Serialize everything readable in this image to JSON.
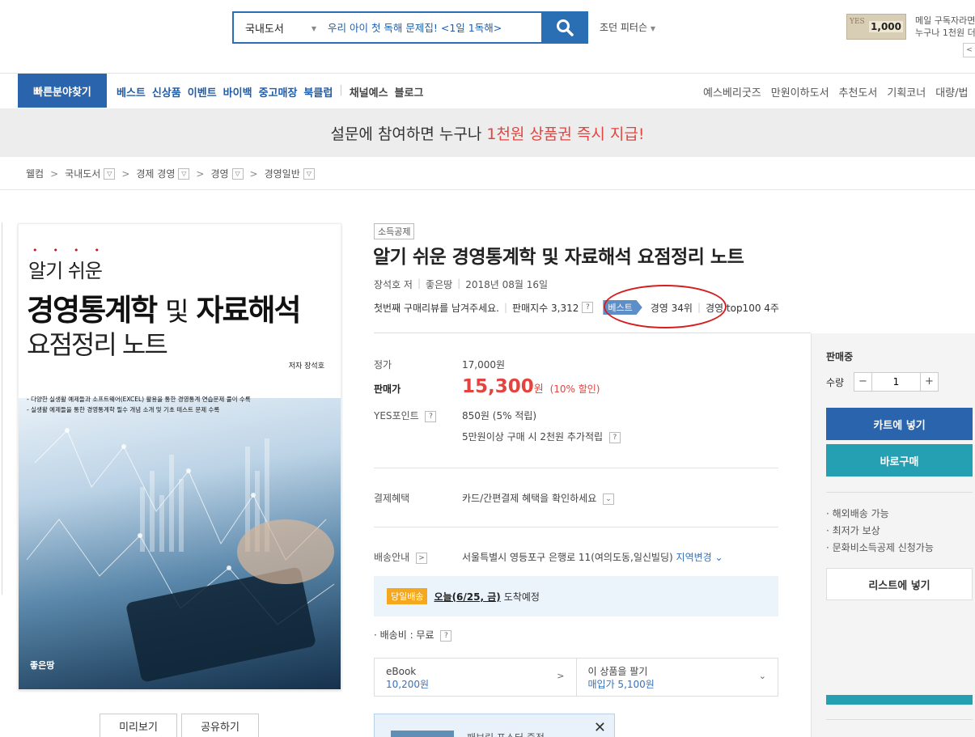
{
  "search": {
    "category": "국내도서",
    "placeholder": "우리 아이 첫 독해 문제집! <1일 1독해>"
  },
  "user_menu": "조던 피터슨",
  "promo": {
    "amount": "1,000",
    "card_mark": "YES",
    "line1": "메일 구독자라면",
    "line2": "누구나 1천원 더"
  },
  "nav": {
    "quick": "빠른분야찾기",
    "main_blue": [
      "베스트",
      "신상품",
      "이벤트",
      "바이백",
      "중고매장",
      "북클럽"
    ],
    "main_dark": [
      "채널예스",
      "블로그"
    ],
    "right": [
      "예스베리굿즈",
      "만원이하도서",
      "추천도서",
      "기획코너",
      "대량/법"
    ]
  },
  "banner": {
    "text": "설문에 참여하면 누구나",
    "highlight": "1천원 상품권 즉시 지급!"
  },
  "breadcrumb": [
    "웰컴",
    "국내도서",
    "경제 경영",
    "경영",
    "경영일반"
  ],
  "cover": {
    "sub1": "알기 쉬운",
    "title_a": "경영통계학",
    "title_b": "및",
    "title_c": "자료해석",
    "sub2": "요점정리 노트",
    "author": "저자 장석호",
    "note1": "- 다양한 실생활 예제들과 소프트웨어(EXCEL) 활용을 통한 경영통계 연습문제 풀이 수록",
    "note2": "- 실생활 예제들을 통한 경영통계학 필수 개념 소개 및 기초 테스트 문제 수록",
    "publisher": "좋은땅"
  },
  "buttons": {
    "preview": "미리보기",
    "share": "공유하기"
  },
  "product": {
    "tag": "소득공제",
    "title": "알기 쉬운 경영통계학 및 자료해석 요점정리 노트",
    "author": "장석호 저",
    "publisher": "좋은땅",
    "date": "2018년 08월 16일",
    "review": "첫번째 구매리뷰를 남겨주세요.",
    "sales_index": "판매지수 3,312",
    "best_badge": "베스트",
    "rank1": "경영 34위",
    "rank2": "경영 top100 4주"
  },
  "price": {
    "list_label": "정가",
    "list_value": "17,000원",
    "sale_label": "판매가",
    "sale_value": "15,300",
    "sale_unit": "원",
    "discount": "(10% 할인)",
    "point_label": "YES포인트",
    "point_value": "850원 (5% 적립)",
    "point_extra": "5만원이상 구매 시 2천원 추가적립"
  },
  "payment": {
    "label": "결제혜택",
    "value": "카드/간편결제 혜택을 확인하세요"
  },
  "shipping": {
    "label": "배송안내",
    "address": "서울특별시 영등포구 은행로 11(여의도동,일신빌딩)",
    "change": "지역변경",
    "same_day_badge": "당일배송",
    "same_day_date": "오늘(6/25, 금)",
    "same_day_text": "도착예정",
    "fee": "· 배송비 : 무료"
  },
  "ebook": {
    "label": "eBook",
    "price": "10,200원",
    "sell_label": "이 상품을 팔기",
    "sell_price": "매입가 5,100원"
  },
  "ad": {
    "text": "패브릭 포스터 증정"
  },
  "side": {
    "status": "판매중",
    "qty_label": "수량",
    "qty_value": "1",
    "minus": "−",
    "plus": "+",
    "cart": "카트에 넣기",
    "buy": "바로구매",
    "bullets": [
      "· 해외배송 가능",
      "· 최저가 보상",
      "· 문화비소득공제 신청가능"
    ],
    "list": "리스트에 넣기"
  },
  "colors": {
    "brand_blue": "#2a64ad",
    "teal": "#25a0b3",
    "sale_red": "#e3443f",
    "rank_circle": "#d61e1e"
  }
}
